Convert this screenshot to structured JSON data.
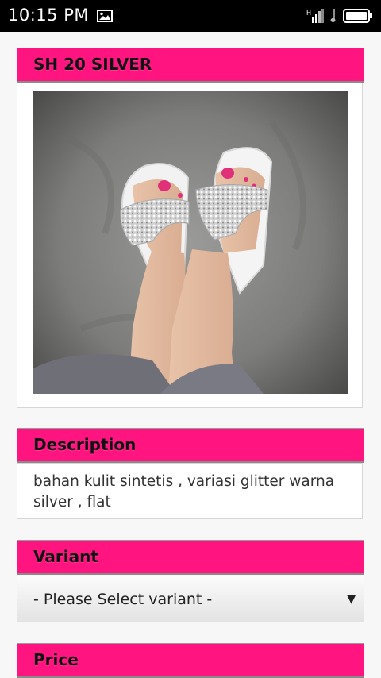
{
  "status": {
    "time": "10:15 PM",
    "icons": [
      "image-icon",
      "signal-icon",
      "battery-icon"
    ]
  },
  "product": {
    "title": "SH 20 SILVER"
  },
  "description": {
    "heading": "Description",
    "text": "bahan kulit sintetis , variasi glitter warna silver , flat"
  },
  "variant": {
    "heading": "Variant",
    "selected": "- Please Select variant -"
  },
  "price": {
    "heading": "Price"
  },
  "colors": {
    "accent": "#ff1480",
    "statusbar": "#000000"
  }
}
